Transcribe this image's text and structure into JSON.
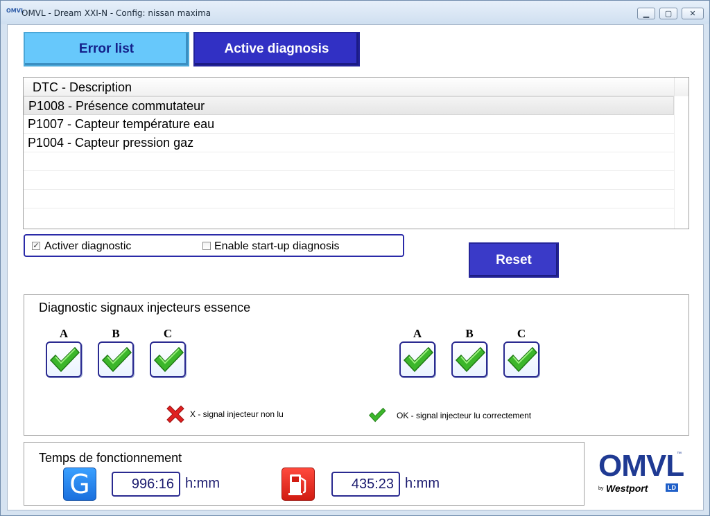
{
  "window": {
    "title": "OMVL - Dream XXI-N - Config: nissan maxima",
    "app_icon_text": "OMVL",
    "minimize": "▁",
    "maximize": "▢",
    "close": "✕"
  },
  "tabs": [
    {
      "label": "Error list",
      "active": false
    },
    {
      "label": "Active diagnosis",
      "active": true
    }
  ],
  "dtc_list": {
    "header": "DTC  -  Description",
    "rows": [
      "P1008 - Présence commutateur",
      "P1007 - Capteur température eau",
      "P1004 - Capteur pression gaz"
    ],
    "selected_index": 0
  },
  "options": {
    "activer_diagnostic": {
      "label": "Activer diagnostic",
      "checked": true
    },
    "enable_startup": {
      "label": "Enable start-up diagnosis",
      "checked": false
    }
  },
  "reset_label": "Reset",
  "injectors": {
    "title": "Diagnostic signaux injecteurs essence",
    "group1": [
      {
        "letter": "A",
        "status": "ok"
      },
      {
        "letter": "B",
        "status": "ok"
      },
      {
        "letter": "C",
        "status": "ok"
      }
    ],
    "group2": [
      {
        "letter": "A",
        "status": "ok"
      },
      {
        "letter": "B",
        "status": "ok"
      },
      {
        "letter": "C",
        "status": "ok"
      }
    ],
    "legend_x": "X - signal injecteur non lu",
    "legend_ok": "OK - signal injecteur lu correctement"
  },
  "operating_time": {
    "title": "Temps de fonctionnement",
    "gas_icon_letter": "G",
    "gas_value": "996:16",
    "gas_unit": "h:mm",
    "petrol_value": "435:23",
    "petrol_unit": "h:mm"
  },
  "logo": {
    "main": "OMVL",
    "tm": "™",
    "by": "by",
    "brand": "Westport",
    "ld": "LD"
  },
  "colors": {
    "tab_error_bg": "#67c8fb",
    "tab_active_bg": "#3130c4",
    "reset_bg": "#3a3ac8",
    "check_green": "#3cb62b",
    "x_red": "#e02020",
    "logo_blue": "#1f3a93"
  }
}
